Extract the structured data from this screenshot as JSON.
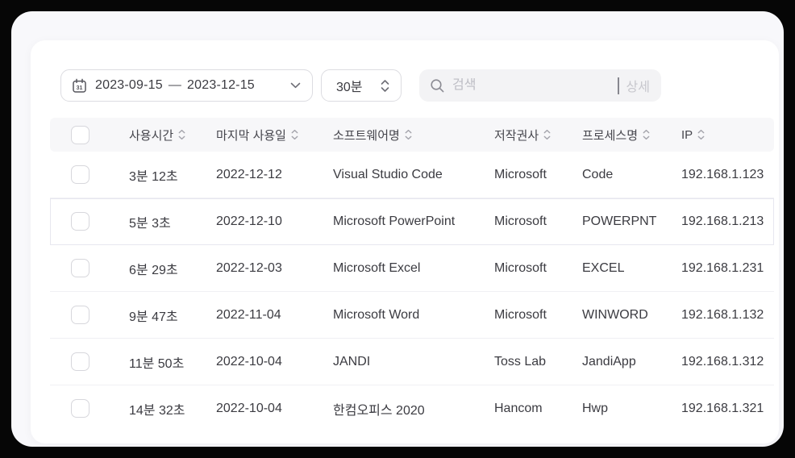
{
  "colors": {
    "frame": "#060606",
    "page_background": "#f8f8fb",
    "card_background": "#ffffff",
    "header_background": "#f7f7f9",
    "row_divider": "#f0f0f4",
    "highlight_border": "#e7e7ef",
    "text_primary": "#3b3b41",
    "text_header": "#46464d",
    "placeholder": "#bdbdc4",
    "detail_text": "#c7c7cd",
    "control_border": "#dcdce1",
    "search_background": "#f3f3f5"
  },
  "icons": {
    "calendar": "calendar-icon (31)",
    "chevron_down": "chevron-down-icon",
    "stepper": "up-down-stepper-icon",
    "search": "search-icon (magnifier)",
    "sort": "sort-arrows-icon"
  },
  "toolbar": {
    "date_range": {
      "start": "2023-09-15",
      "separator": "—",
      "end": "2023-12-15"
    },
    "interval": {
      "value": "30분"
    },
    "search": {
      "placeholder": "검색",
      "value": "",
      "detail_label": "상세"
    }
  },
  "table": {
    "highlighted_row_index": 1,
    "columns": [
      {
        "key": "usage_time",
        "label": "사용시간",
        "sortable": true
      },
      {
        "key": "last_used",
        "label": "마지막 사용일",
        "sortable": true
      },
      {
        "key": "software",
        "label": "소프트웨어명",
        "sortable": true
      },
      {
        "key": "vendor",
        "label": "저작권사",
        "sortable": true
      },
      {
        "key": "process",
        "label": "프로세스명",
        "sortable": true
      },
      {
        "key": "ip",
        "label": "IP",
        "sortable": true
      }
    ],
    "rows": [
      {
        "usage_time": "3분 12초",
        "last_used": "2022-12-12",
        "software": "Visual Studio Code",
        "vendor": "Microsoft",
        "process": "Code",
        "ip": "192.168.1.123"
      },
      {
        "usage_time": "5분 3초",
        "last_used": "2022-12-10",
        "software": "Microsoft PowerPoint",
        "vendor": "Microsoft",
        "process": "POWERPNT",
        "ip": "192.168.1.213"
      },
      {
        "usage_time": "6분 29초",
        "last_used": "2022-12-03",
        "software": "Microsoft Excel",
        "vendor": "Microsoft",
        "process": "EXCEL",
        "ip": "192.168.1.231"
      },
      {
        "usage_time": "9분 47초",
        "last_used": "2022-11-04",
        "software": "Microsoft Word",
        "vendor": "Microsoft",
        "process": "WINWORD",
        "ip": "192.168.1.132"
      },
      {
        "usage_time": "11분 50초",
        "last_used": "2022-10-04",
        "software": "JANDI",
        "vendor": "Toss Lab",
        "process": "JandiApp",
        "ip": "192.168.1.312"
      },
      {
        "usage_time": "14분 32초",
        "last_used": "2022-10-04",
        "software": "한컴오피스 2020",
        "vendor": "Hancom",
        "process": "Hwp",
        "ip": "192.168.1.321"
      }
    ]
  }
}
